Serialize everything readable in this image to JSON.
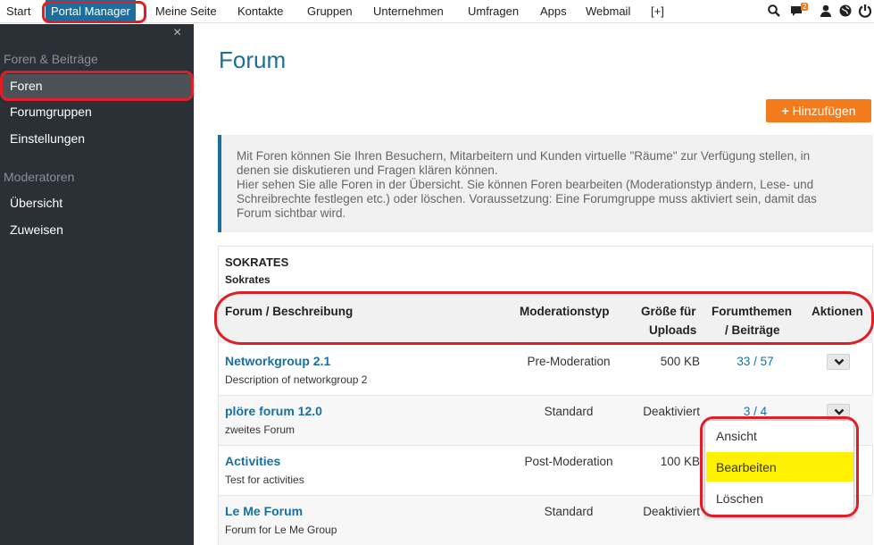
{
  "topnav": {
    "items": [
      "Start",
      "Portal Manager",
      "Meine Seite",
      "Kontakte",
      "Gruppen",
      "Unternehmen",
      "Umfragen",
      "Apps",
      "Webmail",
      "[+]"
    ],
    "notification_count": "2",
    "icons": [
      "search-icon",
      "chat-icon",
      "user-icon",
      "globe-icon",
      "power-icon"
    ]
  },
  "sidebar": {
    "close": "×",
    "sections": [
      {
        "title": "Foren & Beiträge",
        "items": [
          "Foren",
          "Forumgruppen",
          "Einstellungen"
        ]
      },
      {
        "title": "Moderatoren",
        "items": [
          "Übersicht",
          "Zuweisen"
        ]
      }
    ]
  },
  "main": {
    "title": "Forum",
    "add_button": "Hinzufügen",
    "info_lines": [
      "Mit Foren können Sie Ihren Besuchern, Mitarbeitern und Kunden virtuelle \"Räume\" zur Verfügung stellen, in",
      "denen sie diskutieren und Fragen klären können.",
      "Hier sehen Sie alle Foren in der Übersicht. Sie können Foren bearbeiten (Moderationstyp ändern, Lese- und",
      "Schreibrechte festlegen etc.) oder löschen. Voraussetzung: Eine Forumgruppe muss aktiviert sein, damit das",
      "Forum sichtbar wird."
    ],
    "group_title": "SOKRATES",
    "group_subtitle": "Sokrates",
    "columns": {
      "forum": "Forum / Beschreibung",
      "moderation": "Moderationstyp",
      "size_1": "Größe für",
      "size_2": "Uploads",
      "topics_1": "Forumthemen",
      "topics_2": "/ Beiträge",
      "actions": "Aktionen"
    },
    "rows": [
      {
        "name": "Networkgroup 2.1",
        "desc": "Description of networkgroup 2",
        "moderation": "Pre-Moderation",
        "size": "500 KB",
        "count": "33 / 57"
      },
      {
        "name": "plöre forum 12.0",
        "desc": "zweites Forum",
        "moderation": "Standard",
        "size": "Deaktiviert",
        "count": "3 / 4"
      },
      {
        "name": "Activities",
        "desc": "Test for activities",
        "moderation": "Post-Moderation",
        "size": "100 KB",
        "count": ""
      },
      {
        "name": "Le Me Forum",
        "desc": "Forum for Le Me Group",
        "moderation": "Standard",
        "size": "Deaktiviert",
        "count": ""
      }
    ],
    "dropdown": [
      "Ansicht",
      "Bearbeiten",
      "Löschen"
    ]
  },
  "colors": {
    "accent": "#1b6f9e",
    "orange": "#f27b1b",
    "highlight": "#fff200",
    "annotation": "#e01e25",
    "sidebar": "#2b2f36"
  }
}
